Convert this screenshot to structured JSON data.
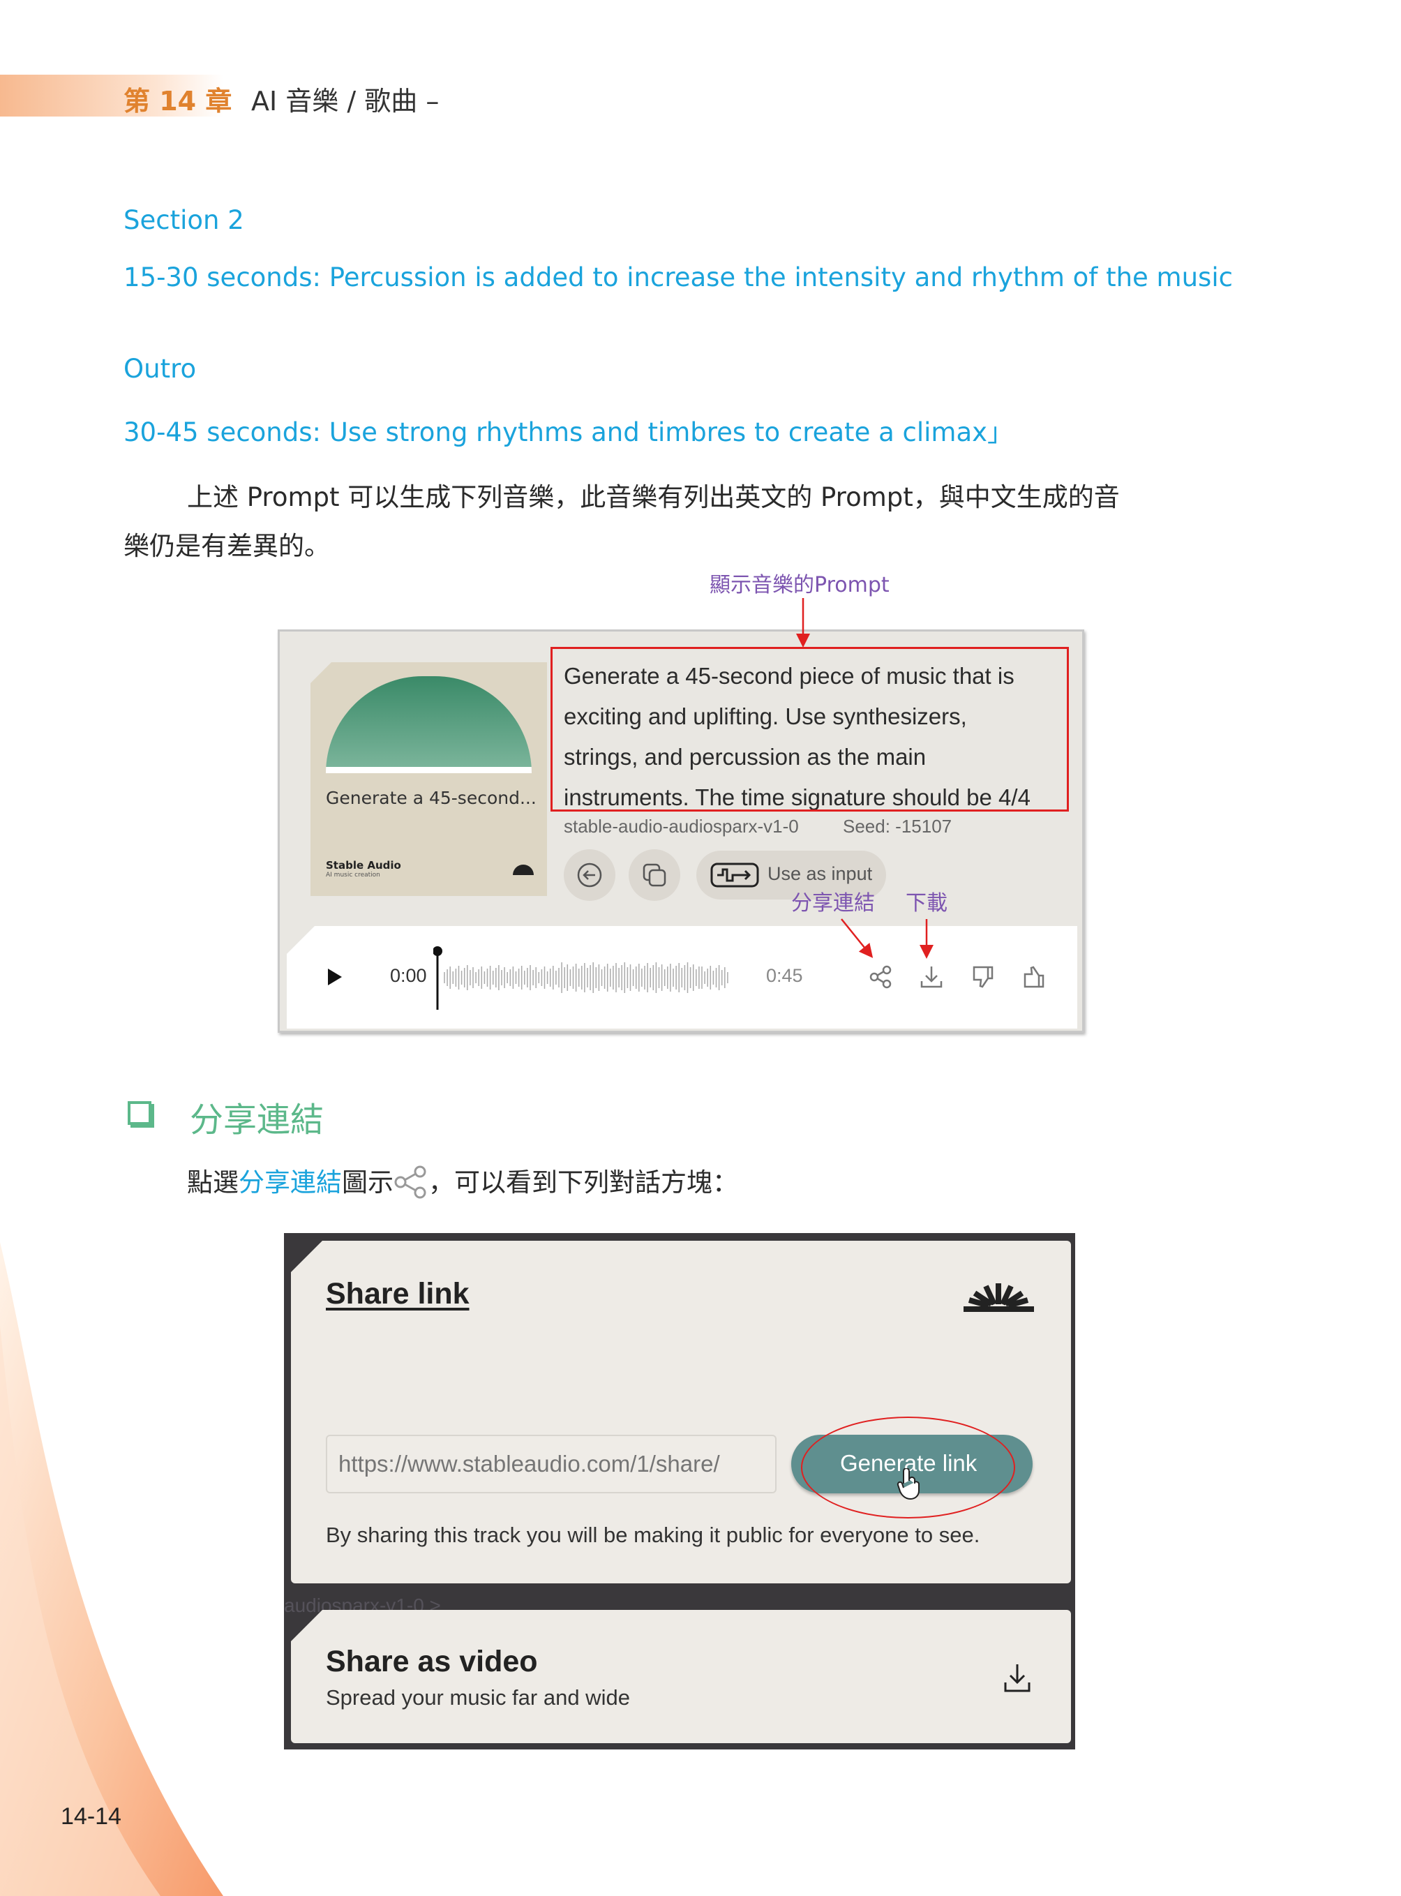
{
  "header": {
    "chapter": "第 14 章",
    "title": "AI 音樂 / 歌曲 –"
  },
  "prompt_lines": [
    "Section 2",
    "15-30 seconds: Percussion is added to increase the intensity and rhythm of the music",
    "Outro",
    "30-45 seconds: Use strong rhythms and timbres to create a climax」"
  ],
  "paragraph": {
    "line1": "上述 Prompt 可以生成下列音樂，此音樂有列出英文的 Prompt，與中文生成的音",
    "line2": "樂仍是有差異的。"
  },
  "annotations": {
    "prompt": "顯示音樂的Prompt",
    "share": "分享連結",
    "download": "下載"
  },
  "track_card": {
    "art_title": "Generate a 45-second...",
    "brand": "Stable Audio",
    "brand_sub": "AI music creation",
    "prompt_text": [
      "Generate a 45-second piece of music that is",
      "exciting and uplifting. Use synthesizers,",
      "strings, and percussion as the main",
      "instruments. The time signature should be 4/4"
    ],
    "model": "stable-audio-audiosparx-v1-0",
    "seed": "Seed: -15107",
    "use_as_input": "Use as input",
    "time_current": "0:00",
    "time_total": "0:45",
    "progress": 0,
    "icons": [
      "replay-icon",
      "copy-icon",
      "waveform-input-icon",
      "play-icon",
      "share-icon",
      "download-icon",
      "thumbs-down-icon",
      "thumbs-up-icon"
    ]
  },
  "section": {
    "heading": "分享連結"
  },
  "instruction": {
    "before": "點選",
    "link": "分享連結",
    "after_link": "圖示",
    "rest": "，可以看到下列對話方塊："
  },
  "dialog": {
    "share_link_title": "Share link",
    "url_placeholder": "https://www.stableaudio.com/1/share/",
    "generate_button": "Generate link",
    "note": "By sharing this track you will be making it public for everyone to see.",
    "behind_text": "audiosparx-v1-0  >",
    "share_video_title": "Share as video",
    "share_video_sub": "Spread your music far and wide",
    "accent": "#5f8f8f"
  },
  "page_number": "14-14",
  "colors": {
    "chapter": "#e0822e",
    "prompt_blue": "#1aa3dc",
    "heading_green": "#5cb88a",
    "annotation": "#7d55b0",
    "highlight_red": "#e02020"
  }
}
